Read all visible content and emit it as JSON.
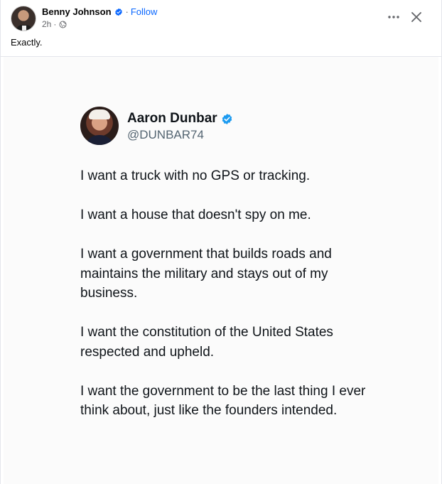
{
  "post": {
    "author_name": "Benny Johnson",
    "separator": "·",
    "follow_label": "Follow",
    "timestamp": "2h",
    "meta_separator": "·",
    "caption": "Exactly.",
    "accent_color": "#0866ff",
    "icons": {
      "verified": "verified-badge-icon",
      "audience": "globe-icon",
      "more": "more-horizontal-icon",
      "close": "close-icon"
    }
  },
  "tweet": {
    "name": "Aaron Dunbar",
    "handle": "@DUNBAR74",
    "paragraphs": [
      "I want a truck with no GPS or tracking.",
      "I want a house that doesn't spy on me.",
      "I want a government that builds roads and maintains the military and stays out of my business.",
      "I want the constitution of the United States respected and upheld.",
      "I want the government to be the last thing I ever think about, just like the founders intended."
    ],
    "verified_color": "#1d9bf0"
  }
}
